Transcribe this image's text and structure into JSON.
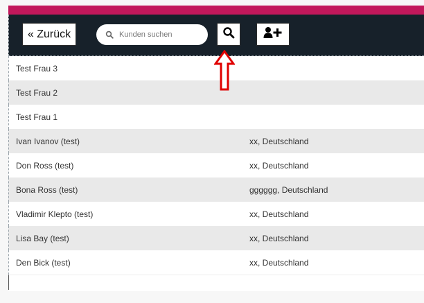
{
  "toolbar": {
    "back_label": "« Zurück",
    "search_placeholder": "Kunden suchen",
    "search_value": ""
  },
  "colors": {
    "accent": "#c2185b",
    "toolbar_bg": "#17212a",
    "annotation_arrow": "#e00000"
  },
  "icons": {
    "search_field": "magnifier-icon",
    "search_button": "magnifier-icon",
    "add_button": "add-user-icon",
    "annotation": "arrow-up-outline"
  },
  "customers": [
    {
      "name": "Test Frau 3",
      "location": ""
    },
    {
      "name": "Test Frau 2",
      "location": ""
    },
    {
      "name": "Test Frau 1",
      "location": ""
    },
    {
      "name": "Ivan Ivanov (test)",
      "location": "xx, Deutschland"
    },
    {
      "name": "Don Ross (test)",
      "location": "xx, Deutschland"
    },
    {
      "name": "Bona Ross (test)",
      "location": "gggggg, Deutschland"
    },
    {
      "name": "Vladimir Klepto (test)",
      "location": "xx, Deutschland"
    },
    {
      "name": "Lisa Bay (test)",
      "location": "xx, Deutschland"
    },
    {
      "name": "Den Bick (test)",
      "location": "xx, Deutschland"
    }
  ]
}
